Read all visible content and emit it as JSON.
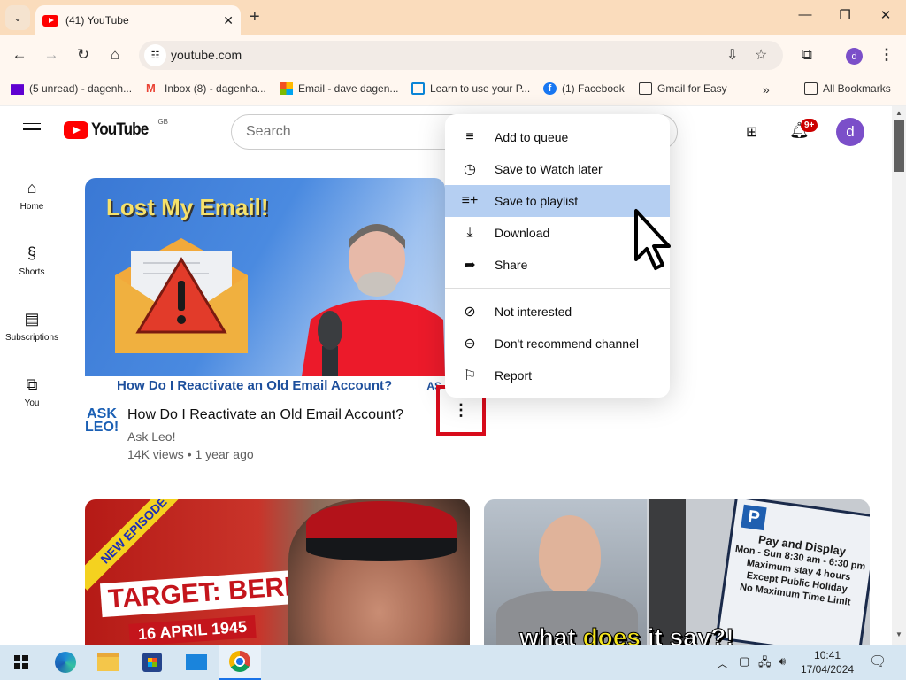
{
  "browser": {
    "tab_title": "(41) YouTube",
    "url": "youtube.com",
    "bookmarks": [
      {
        "label": "(5 unread) - dagenh...",
        "icon": "yahoo-mail-icon",
        "color": "#5f01d1"
      },
      {
        "label": "Inbox (8) - dagenha...",
        "icon": "gmail-icon",
        "color": "#ea4335"
      },
      {
        "label": "Email - dave dagen...",
        "icon": "microsoft-icon",
        "color": "#0078d4"
      },
      {
        "label": "Learn to use your P...",
        "icon": "monitor-icon",
        "color": "#0a84d6"
      },
      {
        "label": "(1) Facebook",
        "icon": "facebook-icon",
        "color": "#1877f2"
      },
      {
        "label": "Gmail for Easy",
        "icon": "folder-icon",
        "color": "#333333"
      }
    ],
    "overflow_label": "»",
    "all_bookmarks": "All Bookmarks",
    "profile_initial": "d"
  },
  "youtube": {
    "logo_text": "YouTube",
    "region": "GB",
    "search_placeholder": "Search",
    "notification_count": "9+",
    "avatar_initial": "d",
    "sidebar": [
      {
        "label": "Home",
        "icon": "home-icon"
      },
      {
        "label": "Shorts",
        "icon": "shorts-icon"
      },
      {
        "label": "Subscriptions",
        "icon": "subscriptions-icon"
      },
      {
        "label": "You",
        "icon": "you-icon"
      }
    ],
    "video": {
      "thumb_headline": "Lost My Email!",
      "thumb_banner": "How Do I Reactivate an Old Email Account?",
      "thumb_corner": "AS",
      "channel_logo": "ASK LEO!",
      "title": "How Do I Reactivate an Old Email Account?",
      "channel": "Ask Leo!",
      "views": "14K views",
      "age": "1 year ago"
    },
    "video2": {
      "badge": "NEW EPISODE",
      "headline": "TARGET: BERLIN",
      "sub": "16 APRIL 1945"
    },
    "video3": {
      "sign_title": "Pay and Display",
      "sign_lines": [
        "Mon - Sun 8:30 am - 6:30 pm",
        "Maximum stay 4 hours",
        "Except Public Holiday",
        "No Maximum Time Limit"
      ],
      "caption_a": "what ",
      "caption_b": "does",
      "caption_c": " it say?!"
    },
    "menu": [
      {
        "label": "Add to queue",
        "icon": "add-to-queue-icon"
      },
      {
        "label": "Save to Watch later",
        "icon": "clock-icon"
      },
      {
        "label": "Save to playlist",
        "icon": "playlist-add-icon",
        "highlighted": true
      },
      {
        "label": "Download",
        "icon": "download-icon"
      },
      {
        "label": "Share",
        "icon": "share-icon"
      },
      {
        "label": "Not interested",
        "icon": "not-interested-icon"
      },
      {
        "label": "Don't recommend channel",
        "icon": "block-icon"
      },
      {
        "label": "Report",
        "icon": "flag-icon"
      }
    ]
  },
  "taskbar": {
    "time": "10:41",
    "date": "17/04/2024"
  },
  "colors": {
    "brand_red": "#ff0000",
    "highlight": "#b5cff2",
    "annotation_red": "#d80b1b",
    "avatar": "#7b4fc9"
  }
}
